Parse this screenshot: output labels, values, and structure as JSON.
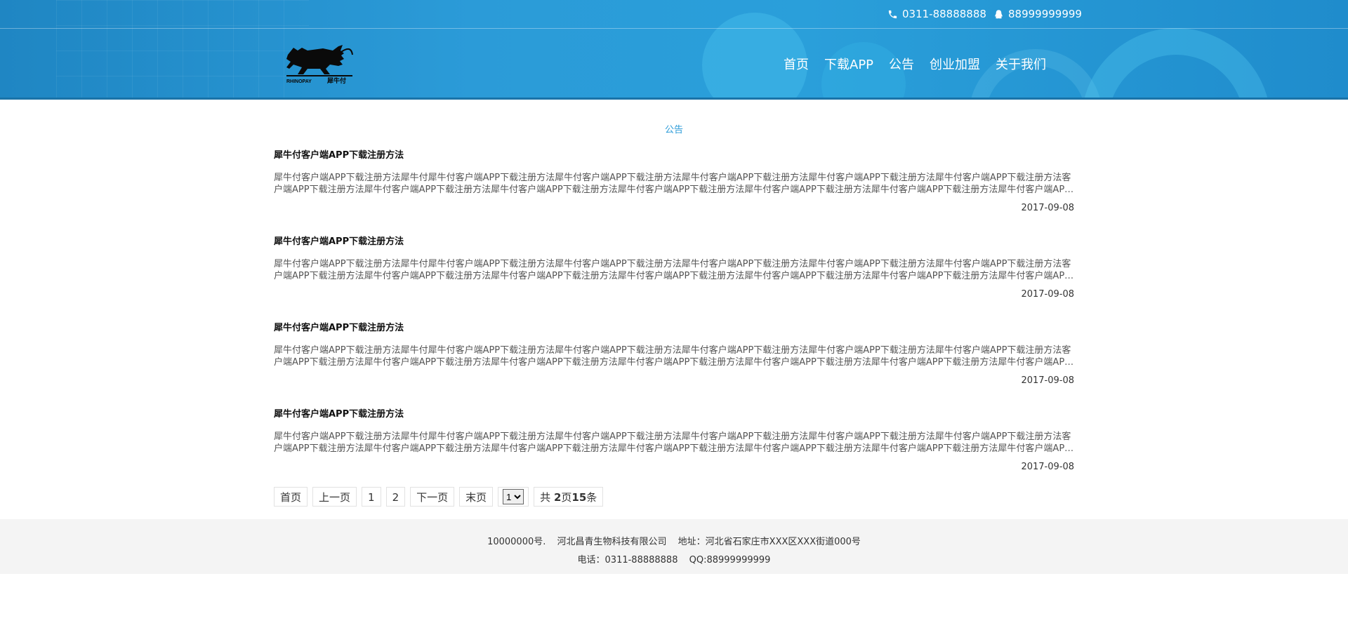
{
  "header": {
    "phone": "0311-88888888",
    "qq": "88999999999",
    "logo_text_left": "RHINOPAY",
    "logo_text_right": "犀牛付",
    "nav": [
      "首页",
      "下载APP",
      "公告",
      "创业加盟",
      "关于我们"
    ]
  },
  "main": {
    "section_title": "公告",
    "articles": [
      {
        "title": "犀牛付客户端APP下载注册方法",
        "body": "犀牛付客户端APP下载注册方法犀牛付犀牛付客户端APP下载注册方法犀牛付客户端APP下载注册方法犀牛付客户端APP下载注册方法犀牛付客户端APP下载注册方法犀牛付客户端APP下载注册方法客户端APP下载注册方法犀牛付客户端APP下载注册方法犀牛付客户端APP下载注册方法犀牛付客户端APP下载注册方法犀牛付客户端APP下载注册方法犀牛付客户端APP下载注册方法犀牛付客户端APP下载注册方法犀牛付客户端APP...",
        "date": "2017-09-08"
      },
      {
        "title": "犀牛付客户端APP下载注册方法",
        "body": "犀牛付客户端APP下载注册方法犀牛付犀牛付客户端APP下载注册方法犀牛付客户端APP下载注册方法犀牛付客户端APP下载注册方法犀牛付客户端APP下载注册方法犀牛付客户端APP下载注册方法客户端APP下载注册方法犀牛付客户端APP下载注册方法犀牛付客户端APP下载注册方法犀牛付客户端APP下载注册方法犀牛付客户端APP下载注册方法犀牛付客户端APP下载注册方法犀牛付客户端APP下载注册方法犀牛付客户端APP...",
        "date": "2017-09-08"
      },
      {
        "title": "犀牛付客户端APP下载注册方法",
        "body": "犀牛付客户端APP下载注册方法犀牛付犀牛付客户端APP下载注册方法犀牛付客户端APP下载注册方法犀牛付客户端APP下载注册方法犀牛付客户端APP下载注册方法犀牛付客户端APP下载注册方法客户端APP下载注册方法犀牛付客户端APP下载注册方法犀牛付客户端APP下载注册方法犀牛付客户端APP下载注册方法犀牛付客户端APP下载注册方法犀牛付客户端APP下载注册方法犀牛付客户端APP下载注册方法犀牛付客户端APP...",
        "date": "2017-09-08"
      },
      {
        "title": "犀牛付客户端APP下载注册方法",
        "body": "犀牛付客户端APP下载注册方法犀牛付犀牛付客户端APP下载注册方法犀牛付客户端APP下载注册方法犀牛付客户端APP下载注册方法犀牛付客户端APP下载注册方法犀牛付客户端APP下载注册方法客户端APP下载注册方法犀牛付客户端APP下载注册方法犀牛付客户端APP下载注册方法犀牛付客户端APP下载注册方法犀牛付客户端APP下载注册方法犀牛付客户端APP下载注册方法犀牛付客户端APP下载注册方法犀牛付客户端APP...",
        "date": "2017-09-08"
      }
    ]
  },
  "pager": {
    "first": "首页",
    "prev": "上一页",
    "page1": "1",
    "page2": "2",
    "next": "下一页",
    "last": "末页",
    "select_value": "1",
    "total_prefix": "共",
    "total_pages": "2",
    "pages_unit": "页",
    "total_items": "15",
    "items_unit": "条"
  },
  "footer": {
    "icp": "10000000号.",
    "company": "河北昌青生物科技有限公司",
    "address": "地址：河北省石家庄市XXX区XXX街道000号",
    "phone": "电话：0311-88888888",
    "qq": "QQ:88999999999"
  },
  "colors": {
    "header_blue": "#2b9bd8",
    "accent": "#2b9bd8",
    "footer_bg": "#f4f4f4"
  }
}
